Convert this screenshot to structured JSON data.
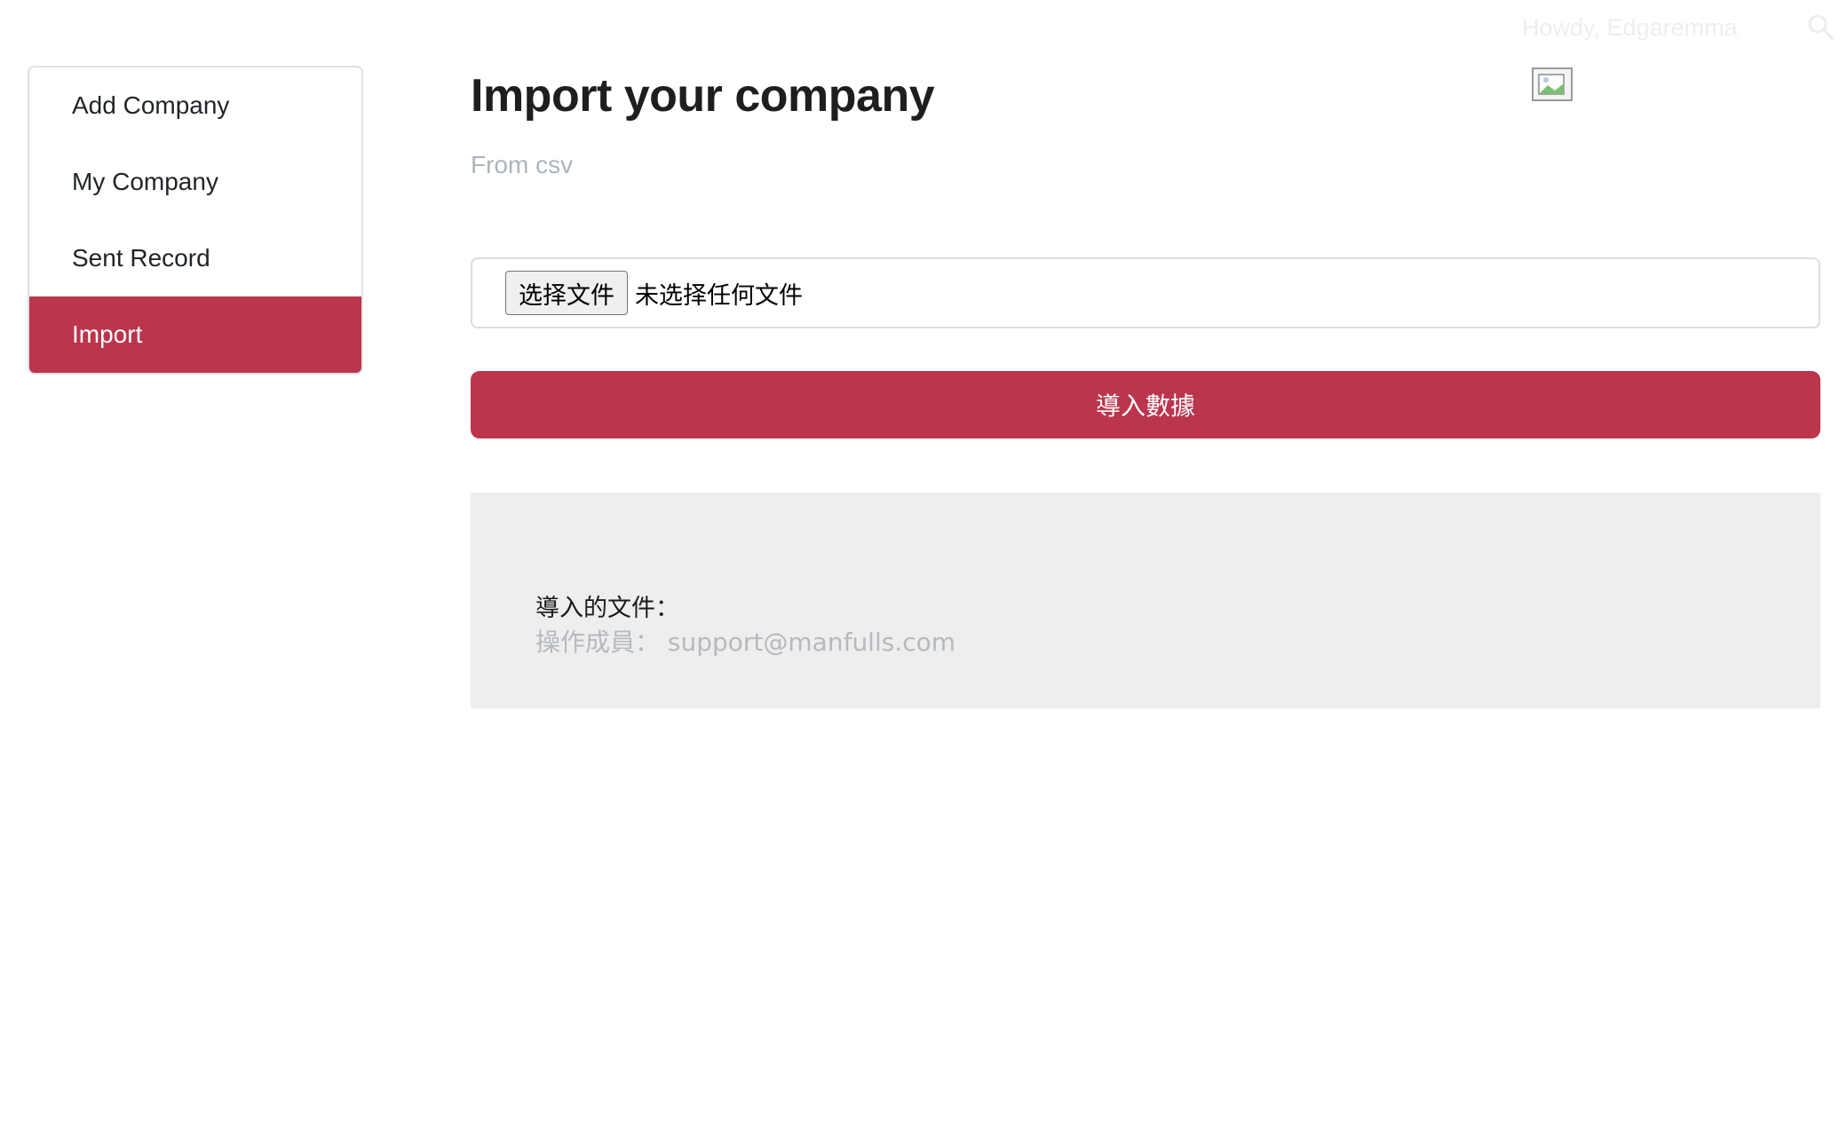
{
  "header": {
    "greeting": "Howdy, Edgaremma",
    "search_icon": "search-icon",
    "avatar_icon": "broken-image-icon"
  },
  "sidebar": {
    "items": [
      {
        "label": "Add Company",
        "active": false
      },
      {
        "label": "My Company",
        "active": false
      },
      {
        "label": "Sent Record",
        "active": false
      },
      {
        "label": "Import",
        "active": true
      }
    ]
  },
  "main": {
    "title": "Import your company",
    "subtitle": "From csv",
    "file_input": {
      "button_label": "选择文件",
      "status_text": "未选择任何文件"
    },
    "import_button_label": "導入數據",
    "result": {
      "file_line": "導入的文件：",
      "operator_line": "操作成員： support@manfulls.com"
    }
  },
  "colors": {
    "accent": "#bb354d",
    "panel_bg": "#eeeeee",
    "muted_text": "#adb5bd"
  }
}
